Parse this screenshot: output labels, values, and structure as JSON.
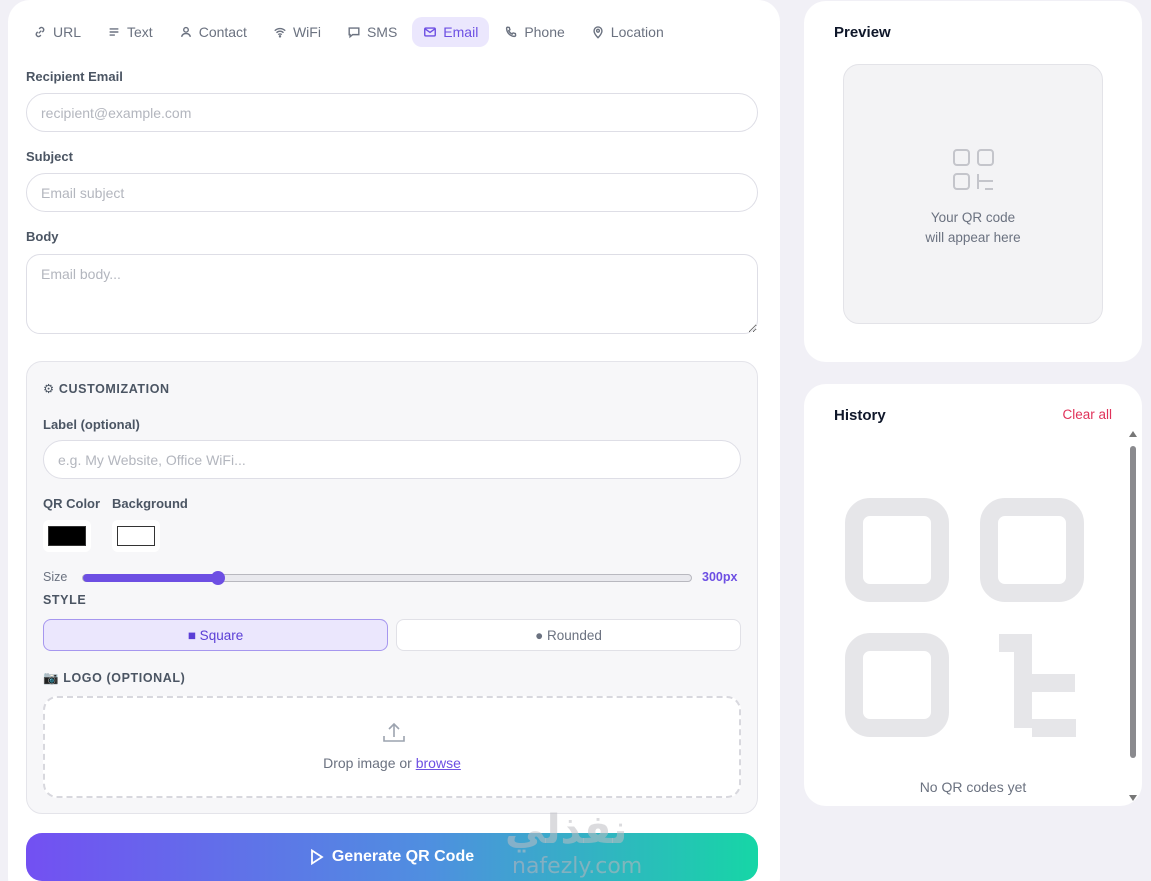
{
  "tabs": [
    {
      "label": "URL",
      "icon": "link-icon",
      "active": false
    },
    {
      "label": "Text",
      "icon": "text-lines-icon",
      "active": false
    },
    {
      "label": "Contact",
      "icon": "user-icon",
      "active": false
    },
    {
      "label": "WiFi",
      "icon": "wifi-icon",
      "active": false
    },
    {
      "label": "SMS",
      "icon": "chat-icon",
      "active": false
    },
    {
      "label": "Email",
      "icon": "mail-icon",
      "active": true
    },
    {
      "label": "Phone",
      "icon": "phone-icon",
      "active": false
    },
    {
      "label": "Location",
      "icon": "map-pin-icon",
      "active": false
    }
  ],
  "form": {
    "recipient": {
      "label": "Recipient Email",
      "placeholder": "recipient@example.com",
      "value": ""
    },
    "subject": {
      "label": "Subject",
      "placeholder": "Email subject",
      "value": ""
    },
    "body": {
      "label": "Body",
      "placeholder": "Email body...",
      "value": ""
    }
  },
  "customization": {
    "title": "⚙ CUSTOMIZATION",
    "label_field": {
      "label": "Label (optional)",
      "placeholder": "e.g. My Website, Office WiFi...",
      "value": ""
    },
    "qr_color": {
      "label": "QR Color",
      "value": "#000000"
    },
    "background": {
      "label": "Background",
      "value": "#ffffff"
    },
    "size": {
      "label": "Size",
      "value_text": "300px",
      "value": 300,
      "min": 100,
      "max": 1000
    },
    "style": {
      "title": "STYLE",
      "options": [
        "■ Square",
        "● Rounded"
      ],
      "selected": "■ Square"
    },
    "logo": {
      "title": "📷 LOGO (OPTIONAL)",
      "drop_text": "Drop image or",
      "browse_text": "browse"
    }
  },
  "generate_button": "Generate QR Code",
  "preview": {
    "title": "Preview",
    "placeholder_line1": "Your QR code",
    "placeholder_line2": "will appear here"
  },
  "history": {
    "title": "History",
    "clear_label": "Clear all",
    "empty_text": "No QR codes yet"
  },
  "watermark": {
    "arabic": "نفذلي",
    "latin": "nafezly.com"
  },
  "colors": {
    "accent": "#6d4fe3",
    "danger": "#e0325a",
    "gradient_start": "#7350f2",
    "gradient_end": "#16d6a6"
  }
}
